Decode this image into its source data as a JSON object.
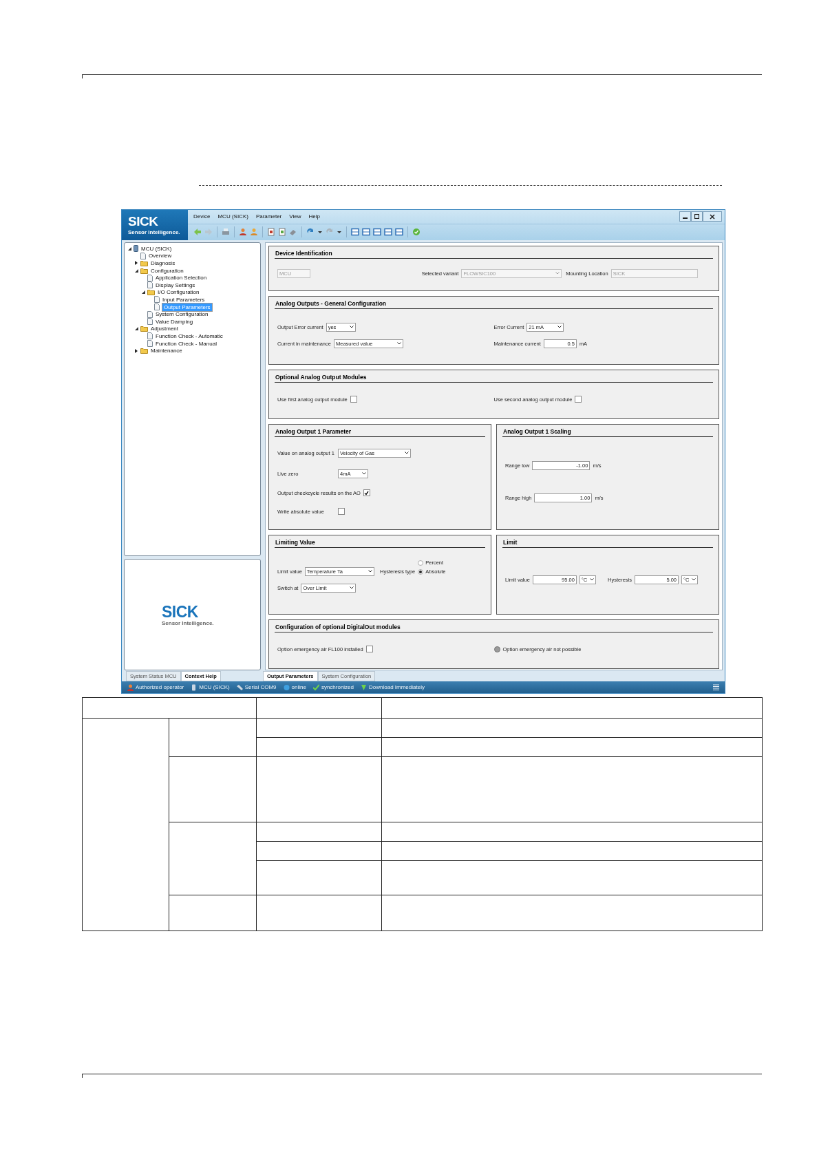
{
  "logo": {
    "name": "SICK",
    "tagline": "Sensor Intelligence."
  },
  "menu": [
    "Device",
    "MCU (SICK)",
    "Parameter",
    "View",
    "Help"
  ],
  "tree": [
    {
      "label": "MCU (SICK)",
      "kind": "device",
      "selected": false,
      "expanded": true,
      "children": [
        {
          "label": "Overview",
          "kind": "page",
          "selected": false
        },
        {
          "label": "Diagnosis",
          "kind": "folder",
          "selected": false,
          "expanded": false
        },
        {
          "label": "Configuration",
          "kind": "folder",
          "selected": false,
          "expanded": true,
          "children": [
            {
              "label": "Application Selection",
              "kind": "page",
              "selected": false
            },
            {
              "label": "Display Settings",
              "kind": "page",
              "selected": false
            },
            {
              "label": "I/O Configuration",
              "kind": "folder",
              "selected": false,
              "expanded": true,
              "children": [
                {
                  "label": "Input Parameters",
                  "kind": "page",
                  "selected": false
                },
                {
                  "label": "Output Parameters",
                  "kind": "page",
                  "selected": true
                }
              ]
            },
            {
              "label": "System Configuration",
              "kind": "page",
              "selected": false
            },
            {
              "label": "Value Damping",
              "kind": "page",
              "selected": false
            }
          ]
        },
        {
          "label": "Adjustment",
          "kind": "folder",
          "selected": false,
          "expanded": true,
          "children": [
            {
              "label": "Function Check - Automatic",
              "kind": "page",
              "selected": false
            },
            {
              "label": "Function Check - Manual",
              "kind": "page",
              "selected": false
            }
          ]
        },
        {
          "label": "Maintenance",
          "kind": "folder",
          "selected": false,
          "expanded": false
        }
      ]
    }
  ],
  "context_panel": {
    "logo_name": "SICK",
    "logo_tagline": "Sensor Intelligence."
  },
  "left_tabs": [
    {
      "label": "System Status MCU",
      "selected": false
    },
    {
      "label": "Context Help",
      "selected": true
    }
  ],
  "panel_rows": [
    [
      {
        "title": "Device Identification",
        "rows": [
          [
            {
              "kind": "input",
              "value": "MCU",
              "disabled": true
            },
            {
              "kind": "select",
              "label": "Selected variant",
              "value": "FLOWSIC100",
              "disabled": true
            },
            {
              "kind": "input",
              "label": "Mounting Location",
              "value": "SICK",
              "disabled": true
            }
          ]
        ]
      }
    ],
    [
      {
        "title": "Analog Outputs - General Configuration",
        "rows": [
          [
            {
              "kind": "select",
              "label": "Output Error current",
              "value": "yes",
              "disabled": false
            },
            {
              "kind": "select",
              "label": "Error Current",
              "value": "21 mA",
              "disabled": false
            }
          ],
          [
            {
              "kind": "select",
              "label": "Current in maintenance",
              "value": "Measured value",
              "disabled": false
            },
            {
              "kind": "input",
              "label": "Maintenance current",
              "value": "0.5",
              "unit": "mA",
              "disabled": false
            }
          ]
        ]
      }
    ],
    [
      {
        "title": "Optional Analog Output Modules",
        "rows": [
          [
            {
              "kind": "checkbox",
              "label": "Use first analog output module",
              "checked": false
            },
            {
              "kind": "checkbox",
              "label": "Use second analog output module",
              "checked": false
            }
          ]
        ]
      }
    ],
    [
      {
        "title": "Analog Output 1 Parameter",
        "rows": [
          [
            {
              "kind": "select",
              "label": "Value on analog output 1",
              "value": "Velocity of Gas",
              "disabled": false
            }
          ],
          [
            {
              "kind": "select",
              "label": "Live zero",
              "value": "4mA",
              "disabled": false
            }
          ],
          [
            {
              "kind": "checkbox",
              "label": "Output checkcycle results on the AO",
              "checked": true
            }
          ],
          [
            {
              "kind": "checkbox",
              "label": "Write absolute value",
              "checked": false
            }
          ]
        ]
      },
      {
        "title": "Analog Output 1 Scaling",
        "rows": [
          [
            {
              "kind": "input",
              "label": "Range low",
              "value": "-1.00",
              "unit": "m/s",
              "disabled": false
            }
          ],
          [
            {
              "kind": "input",
              "label": "Range high",
              "value": "1.00",
              "unit": "m/s",
              "disabled": false
            }
          ]
        ]
      }
    ],
    [
      {
        "title": "Limiting Value",
        "rows": [
          [
            {
              "kind": "select",
              "label": "Limit value",
              "value": "Temperature Ta",
              "disabled": false
            },
            {
              "kind": "radio",
              "label": "Hysteresis type",
              "options": [
                {
                  "label": "Percent",
                  "selected": false
                },
                {
                  "label": "Absolute",
                  "selected": true
                }
              ]
            }
          ],
          [
            {
              "kind": "select",
              "label": "Switch at",
              "value": "Over Limit",
              "disabled": false
            }
          ]
        ]
      },
      {
        "title": "Limit",
        "rows": [
          [
            {
              "kind": "input",
              "label": "Limit value",
              "value": "95.00",
              "unit_select": "°C",
              "disabled": false
            },
            {
              "kind": "input",
              "label": "Hysteresis",
              "value": "5.00",
              "unit_select": "°C",
              "disabled": false
            }
          ]
        ]
      }
    ],
    [
      {
        "title": "Configuration of optional DigitalOut modules",
        "rows": [
          [
            {
              "kind": "checkbox",
              "label": "Option emergency air FL100 installed",
              "checked": false
            },
            {
              "kind": "indicator",
              "label": "Option emergency air not possible"
            }
          ]
        ]
      }
    ]
  ],
  "bottom_tabs": [
    {
      "label": "Output Parameters",
      "selected": true
    },
    {
      "label": "System Configuration",
      "selected": false
    }
  ],
  "status_bar": [
    {
      "kind": "user",
      "text": "Authorized operator"
    },
    {
      "kind": "device",
      "text": "MCU (SICK)"
    },
    {
      "kind": "cable",
      "text": "Serial COM9"
    },
    {
      "kind": "globe",
      "text": "online"
    },
    {
      "kind": "check",
      "text": "synchronized"
    },
    {
      "kind": "download",
      "text": "Download Immediately"
    }
  ]
}
